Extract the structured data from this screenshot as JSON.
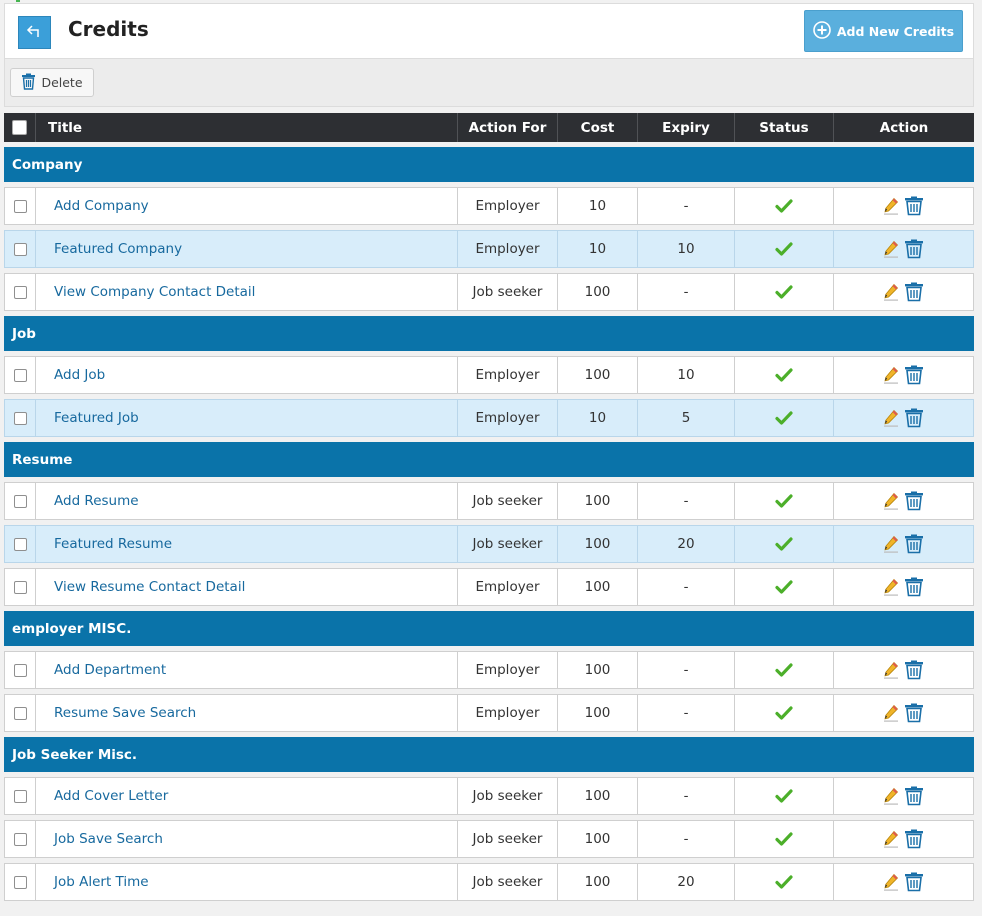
{
  "header": {
    "title": "Credits",
    "add_button_label": "Add New Credits"
  },
  "toolbar": {
    "delete_label": "Delete"
  },
  "table": {
    "columns": {
      "title": "Title",
      "action_for": "Action For",
      "cost": "Cost",
      "expiry": "Expiry",
      "status": "Status",
      "action": "Action"
    },
    "groups": [
      {
        "name": "Company",
        "rows": [
          {
            "title": "Add Company",
            "action_for": "Employer",
            "cost": "10",
            "expiry": "-",
            "status": "enabled",
            "highlighted": false
          },
          {
            "title": "Featured Company",
            "action_for": "Employer",
            "cost": "10",
            "expiry": "10",
            "status": "enabled",
            "highlighted": true
          },
          {
            "title": "View Company Contact Detail",
            "action_for": "Job seeker",
            "cost": "100",
            "expiry": "-",
            "status": "enabled",
            "highlighted": false
          }
        ]
      },
      {
        "name": "Job",
        "rows": [
          {
            "title": "Add Job",
            "action_for": "Employer",
            "cost": "100",
            "expiry": "10",
            "status": "enabled",
            "highlighted": false
          },
          {
            "title": "Featured Job",
            "action_for": "Employer",
            "cost": "10",
            "expiry": "5",
            "status": "enabled",
            "highlighted": true
          }
        ]
      },
      {
        "name": "Resume",
        "rows": [
          {
            "title": "Add Resume",
            "action_for": "Job seeker",
            "cost": "100",
            "expiry": "-",
            "status": "enabled",
            "highlighted": false
          },
          {
            "title": "Featured Resume",
            "action_for": "Job seeker",
            "cost": "100",
            "expiry": "20",
            "status": "enabled",
            "highlighted": true
          },
          {
            "title": "View Resume Contact Detail",
            "action_for": "Employer",
            "cost": "100",
            "expiry": "-",
            "status": "enabled",
            "highlighted": false
          }
        ]
      },
      {
        "name": "employer MISC.",
        "rows": [
          {
            "title": "Add Department",
            "action_for": "Employer",
            "cost": "100",
            "expiry": "-",
            "status": "enabled",
            "highlighted": false
          },
          {
            "title": "Resume Save Search",
            "action_for": "Employer",
            "cost": "100",
            "expiry": "-",
            "status": "enabled",
            "highlighted": false
          }
        ]
      },
      {
        "name": "Job Seeker Misc.",
        "rows": [
          {
            "title": "Add Cover Letter",
            "action_for": "Job seeker",
            "cost": "100",
            "expiry": "-",
            "status": "enabled",
            "highlighted": false
          },
          {
            "title": "Job Save Search",
            "action_for": "Job seeker",
            "cost": "100",
            "expiry": "-",
            "status": "enabled",
            "highlighted": false
          },
          {
            "title": "Job Alert Time",
            "action_for": "Job seeker",
            "cost": "100",
            "expiry": "20",
            "status": "enabled",
            "highlighted": false
          }
        ]
      }
    ]
  },
  "icons": {
    "back": "back-arrow-icon",
    "add": "plus-circle-icon",
    "delete": "trash-icon",
    "status": "check-icon",
    "edit": "pencil-icon"
  },
  "colors": {
    "accent": "#0a73a9",
    "header_bg": "#2d2f33",
    "button_blue": "#5aafdd",
    "row_highlight": "#d8edfa",
    "link": "#17699e",
    "status_green": "#4caf2a"
  }
}
